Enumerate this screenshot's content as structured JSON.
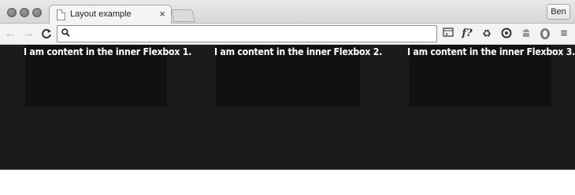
{
  "browser": {
    "tab": {
      "title": "Layout example",
      "close_glyph": "×"
    },
    "profile": {
      "label": "Ben"
    },
    "toolbar": {
      "back_glyph": "←",
      "forward_glyph": "→",
      "reload_glyph": "C",
      "address_value": "",
      "extensions": [
        {
          "name": "page-action-icon",
          "glyph": "▭"
        },
        {
          "name": "fx-icon",
          "glyph": "f?"
        },
        {
          "name": "recycle-icon",
          "glyph": "♻"
        },
        {
          "name": "sync-icon",
          "glyph": "◎"
        },
        {
          "name": "android-icon",
          "glyph": "☗"
        },
        {
          "name": "shield-icon",
          "glyph": "◉"
        }
      ],
      "menu_glyph": "≡"
    }
  },
  "page": {
    "background": "#1b1b1b",
    "flexboxes": [
      {
        "text": "I am content in the inner Flexbox 1."
      },
      {
        "text": "I am content in the inner Flexbox 2."
      },
      {
        "text": "I am content in the inner Flexbox 3."
      }
    ]
  }
}
